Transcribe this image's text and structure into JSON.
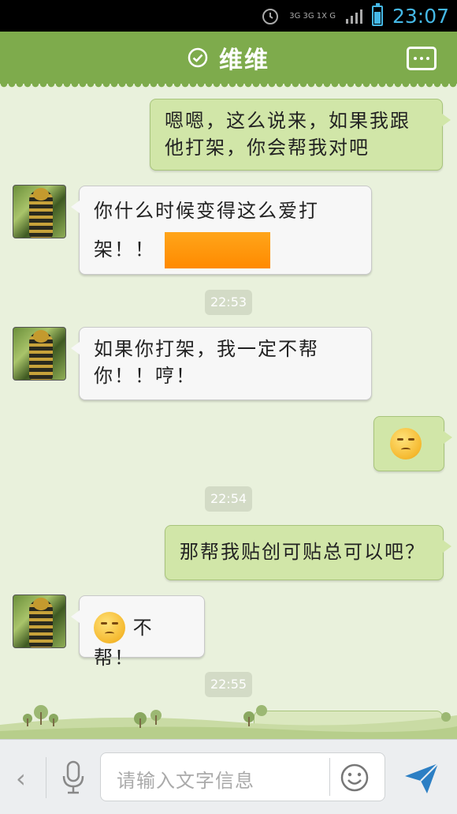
{
  "status_bar": {
    "network_top": "3G 3G 1X G",
    "time": "23:07"
  },
  "header": {
    "title": "维维",
    "check_icon": "check-circle-icon",
    "more_icon": "more-icon"
  },
  "messages": [
    {
      "side": "out",
      "text_line1": "嗯嗯，这么说来，如果我跟",
      "text_line2": "他打架，你会帮我对吧"
    },
    {
      "side": "in",
      "text_line1": "你什么时候变得这么爱打",
      "text_line2": "架！！"
    },
    {
      "side": "time",
      "text": "22:53"
    },
    {
      "side": "in",
      "text_line1": "如果你打架，我一定不帮",
      "text_line2": "你！！哼！"
    },
    {
      "side": "out",
      "emoji": "embarrassed-emoji"
    },
    {
      "side": "time",
      "text": "22:54"
    },
    {
      "side": "out",
      "text": "那帮我贴创可贴总可以吧？"
    },
    {
      "side": "in",
      "emoji": "giggle-emoji",
      "text": "不帮！"
    },
    {
      "side": "time",
      "text": "22:55"
    }
  ],
  "input_bar": {
    "placeholder": "请输入文字信息",
    "back_icon": "chevron-left-icon",
    "mic_icon": "microphone-icon",
    "emoji_icon": "smiley-icon",
    "send_icon": "send-icon"
  },
  "colors": {
    "header_green": "#7eab4c",
    "chat_bg": "#e9f1dc",
    "out_bubble": "#d1e6a8",
    "in_bubble": "#f7f7f7",
    "time_blue": "#45b8e6"
  }
}
